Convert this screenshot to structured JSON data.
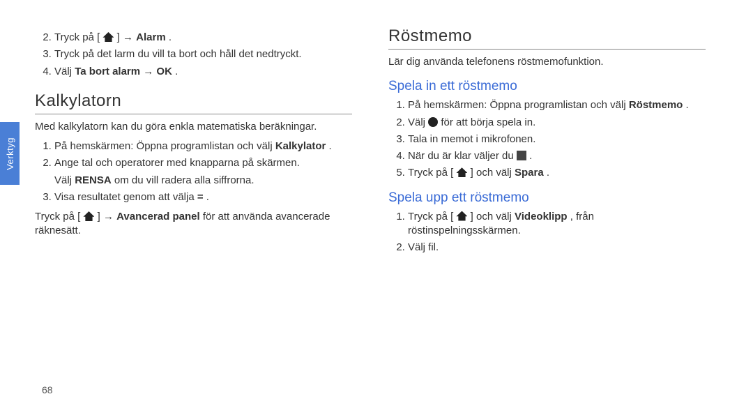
{
  "sideTab": "Verktyg",
  "pageNumber": "68",
  "left": {
    "alarmSteps": {
      "s2a": "Tryck på [",
      "s2b": "] → ",
      "s2c": "Alarm",
      "s2d": ".",
      "s3": "Tryck på det larm du vill ta bort och håll det nedtryckt.",
      "s4a": "Välj ",
      "s4b": "Ta bort alarm → OK",
      "s4c": "."
    },
    "h1": "Kalkylatorn",
    "intro": "Med kalkylatorn kan du göra enkla matematiska beräkningar.",
    "calcSteps": {
      "s1a": "På hemskärmen: Öppna programlistan och välj ",
      "s1b": "Kalkylator",
      "s1c": ".",
      "s2": "Ange tal och operatorer med knapparna på skärmen.",
      "s2suba": "Välj ",
      "s2subb": "RENSA",
      "s2subc": " om du vill radera alla siffrorna.",
      "s3a": "Visa resultatet genom att välja ",
      "s3b": "=",
      "s3c": "."
    },
    "noteA": "Tryck på [",
    "noteB": "] → ",
    "noteC": "Avancerad panel",
    "noteD": " för att använda avancerade räknesätt."
  },
  "right": {
    "h1": "Röstmemo",
    "intro": "Lär dig använda telefonens röstmemofunktion.",
    "h2a": "Spela in ett röstmemo",
    "recSteps": {
      "s1a": "På hemskärmen: Öppna programlistan och välj ",
      "s1b": "Röstmemo",
      "s1c": ".",
      "s2a": "Välj ",
      "s2b": " för att börja spela in.",
      "s3": "Tala in memot i mikrofonen.",
      "s4a": "När du är klar väljer du ",
      "s4b": ".",
      "s5a": "Tryck på [",
      "s5b": "] och välj ",
      "s5c": "Spara",
      "s5d": "."
    },
    "h2b": "Spela upp ett röstmemo",
    "playSteps": {
      "s1a": "Tryck på [",
      "s1b": "] och välj ",
      "s1c": "Videoklipp",
      "s1d": ", från röstinspelningsskärmen.",
      "s2": "Välj fil."
    }
  }
}
